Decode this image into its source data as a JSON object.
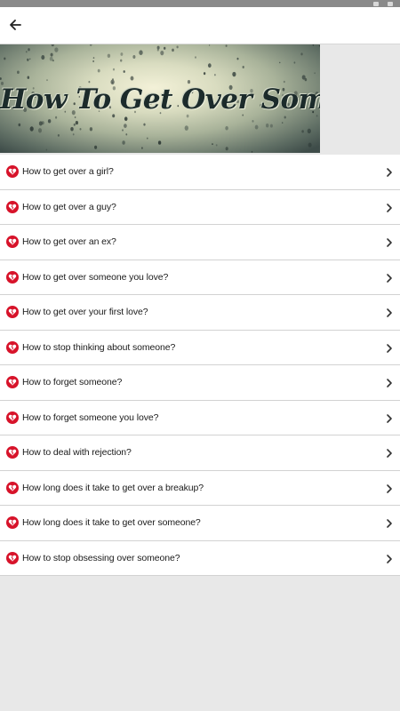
{
  "app_bar": {
    "back_icon": "back-arrow-icon"
  },
  "banner": {
    "title": "How To Get Over Someone"
  },
  "list": {
    "items": [
      {
        "label": "How to get over a girl?"
      },
      {
        "label": "How to get over a guy?"
      },
      {
        "label": "How to get over an ex?"
      },
      {
        "label": "How to get over someone you love?"
      },
      {
        "label": "How to get over your first love?"
      },
      {
        "label": "How to stop thinking about someone?"
      },
      {
        "label": "How to forget someone?"
      },
      {
        "label": "How to forget someone you love?"
      },
      {
        "label": "How to deal with rejection?"
      },
      {
        "label": "How long does it take to get over a breakup?"
      },
      {
        "label": "How long does it take to get over someone?"
      },
      {
        "label": "How to stop obsessing over someone?"
      }
    ],
    "item_icon": "broken-heart-icon",
    "trailing_icon": "chevron-right-icon"
  },
  "colors": {
    "accent_red": "#d7132a",
    "background": "#e8e8e8",
    "list_background": "#ffffff",
    "divider": "#d2d2d2"
  }
}
